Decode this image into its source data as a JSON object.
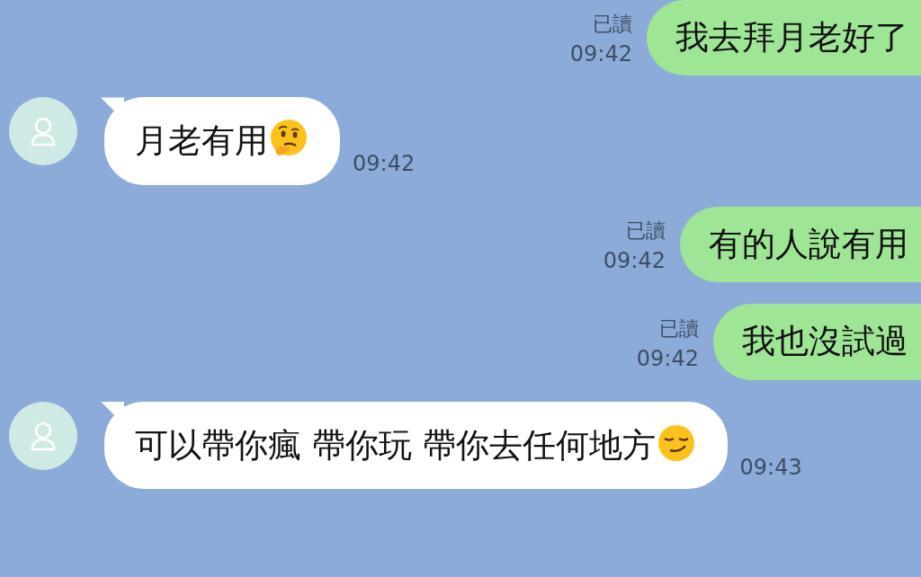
{
  "messages": [
    {
      "kind": "sent",
      "text": "我去拜月老好了",
      "read_label": "已讀",
      "time": "09:42"
    },
    {
      "kind": "received",
      "text": "月老有用",
      "trailing_icon": {
        "kind": "thinking"
      },
      "time": "09:42"
    },
    {
      "kind": "sent",
      "text": "有的人說有用",
      "read_label": "已讀",
      "time": "09:42"
    },
    {
      "kind": "sent",
      "text": "我也沒試過",
      "read_label": "已讀",
      "time": "09:42"
    },
    {
      "kind": "received",
      "text": "可以帶你瘋 帶你玩 帶你去任何地方",
      "trailing_icon": {
        "kind": "smirk"
      },
      "time": "09:43"
    }
  ]
}
